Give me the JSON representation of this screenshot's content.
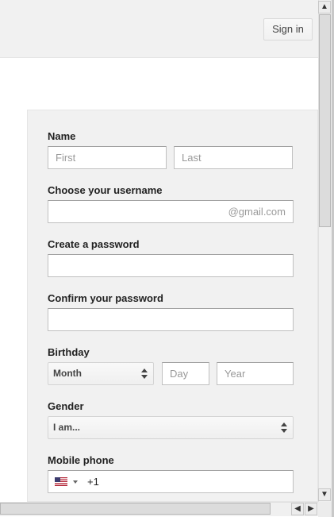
{
  "header": {
    "signin_label": "Sign in"
  },
  "form": {
    "name_label": "Name",
    "first_placeholder": "First",
    "last_placeholder": "Last",
    "username_label": "Choose your username",
    "username_suffix": "@gmail.com",
    "password_label": "Create a password",
    "confirm_label": "Confirm your password",
    "birthday_label": "Birthday",
    "month_value": "Month",
    "day_placeholder": "Day",
    "year_placeholder": "Year",
    "gender_label": "Gender",
    "gender_value": "I am...",
    "phone_label": "Mobile phone",
    "phone_code": "+1",
    "phone_flag_icon": "us-flag-icon"
  },
  "scrollbars": {
    "up_glyph": "▲",
    "down_glyph": "▼",
    "left_glyph": "◀",
    "right_glyph": "▶"
  }
}
